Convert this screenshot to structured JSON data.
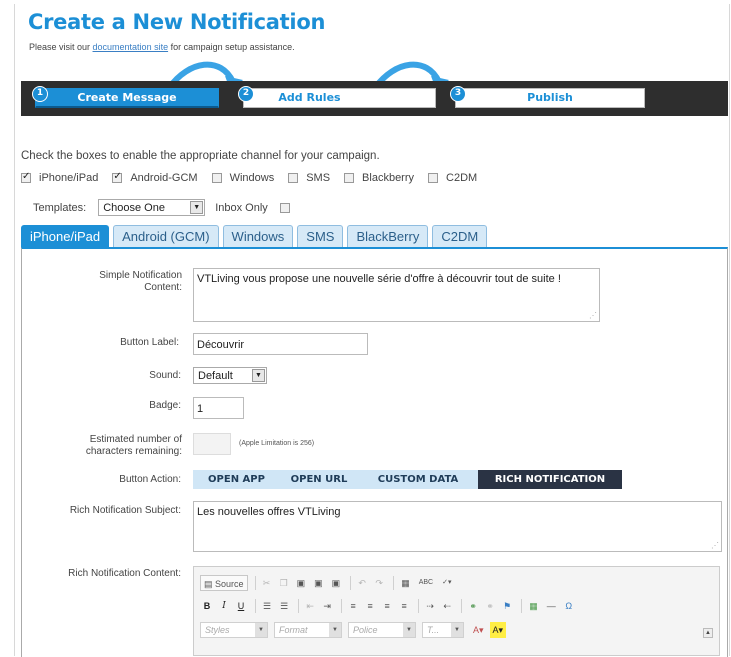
{
  "header": {
    "title": "Create a New Notification",
    "subtitle_prefix": "Please visit our ",
    "subtitle_link": "documentation site",
    "subtitle_suffix": " for campaign setup assistance."
  },
  "wizard": {
    "steps": [
      {
        "number": "1",
        "label": "Create Message",
        "active": true
      },
      {
        "number": "2",
        "label": "Add Rules",
        "active": false
      },
      {
        "number": "3",
        "label": "Publish",
        "active": false
      }
    ]
  },
  "channels": {
    "instruction": "Check the boxes to enable the appropriate channel for your campaign.",
    "items": [
      {
        "label": "iPhone/iPad",
        "checked": true
      },
      {
        "label": "Android-GCM",
        "checked": true
      },
      {
        "label": "Windows",
        "checked": false
      },
      {
        "label": "SMS",
        "checked": false
      },
      {
        "label": "Blackberry",
        "checked": false
      },
      {
        "label": "C2DM",
        "checked": false
      }
    ]
  },
  "templates": {
    "label": "Templates:",
    "selected": "Choose One",
    "inbox_only_label": "Inbox Only",
    "inbox_only_checked": false
  },
  "tabs": [
    {
      "label": "iPhone/iPad",
      "active": true
    },
    {
      "label": "Android (GCM)",
      "active": false
    },
    {
      "label": "Windows",
      "active": false
    },
    {
      "label": "SMS",
      "active": false
    },
    {
      "label": "BlackBerry",
      "active": false
    },
    {
      "label": "C2DM",
      "active": false
    }
  ],
  "form": {
    "simple_content_label": "Simple Notification Content:",
    "simple_content_value": "VTLiving vous propose une nouvelle série d'offre à découvrir tout de suite !",
    "button_label_label": "Button Label:",
    "button_label_value": "Découvrir",
    "sound_label": "Sound:",
    "sound_value": "Default",
    "badge_label": "Badge:",
    "badge_value": "1",
    "chars_label": "Estimated number of characters remaining:",
    "chars_note": "(Apple Limitation is 256)",
    "button_action_label": "Button Action:",
    "button_actions": [
      {
        "label": "OPEN APP",
        "active": false
      },
      {
        "label": "OPEN URL",
        "active": false
      },
      {
        "label": "CUSTOM DATA",
        "active": false
      },
      {
        "label": "RICH NOTIFICATION",
        "active": true
      }
    ],
    "rich_subject_label": "Rich Notification Subject:",
    "rich_subject_value": "Les nouvelles offres VTLiving",
    "rich_content_label": "Rich Notification Content:"
  },
  "editor": {
    "source_label": "Source",
    "styles_placeholder": "Styles",
    "format_placeholder": "Format",
    "font_placeholder": "Police",
    "size_placeholder": "T...",
    "bold": "B",
    "italic": "I",
    "underline": "U",
    "spellcheck_label": "ABC"
  },
  "colors": {
    "accent": "#1c8fd6",
    "wizard_bar": "#2e2e2e",
    "action_active": "#2a3344"
  }
}
